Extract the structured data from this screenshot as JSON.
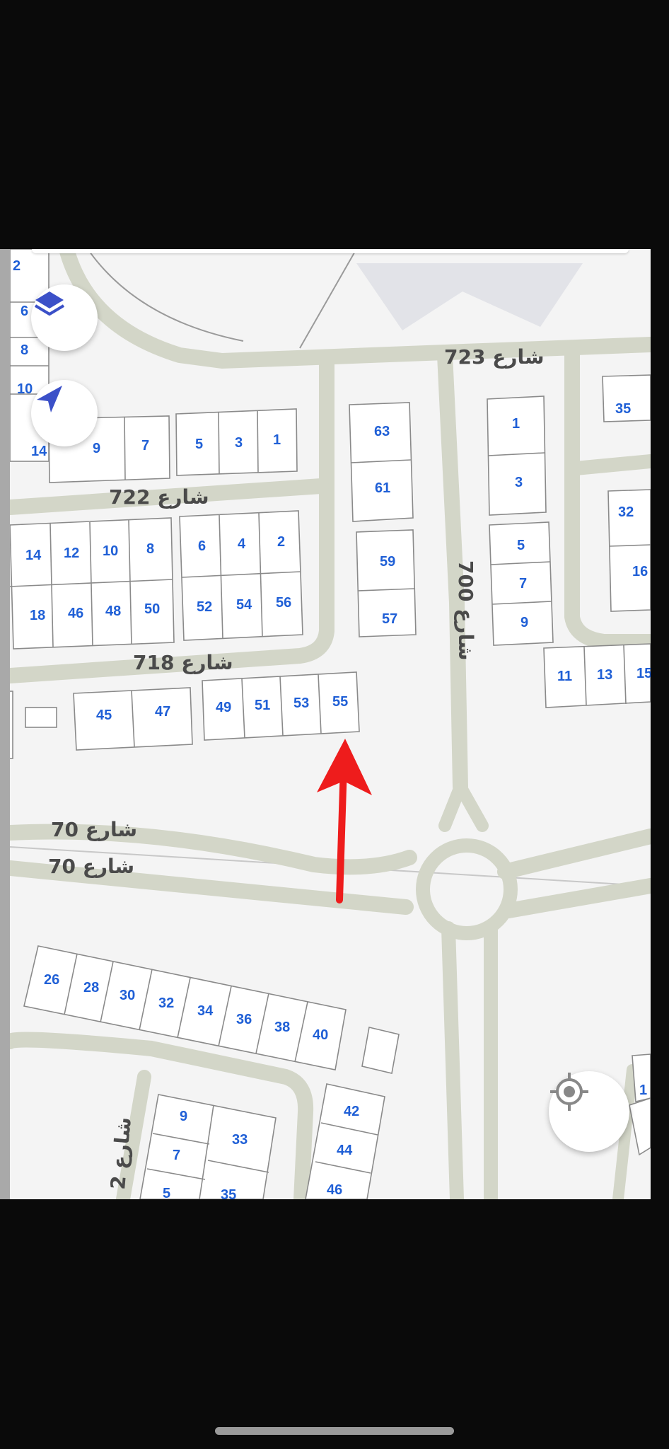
{
  "map": {
    "streets": {
      "s723": "شارع 723",
      "s722": "شارع 722",
      "s718": "شارع 718",
      "s700": "شارع 700",
      "s70a": "شارع 70",
      "s70b": "شارع 70",
      "s2": "شارع 2"
    },
    "plots": {
      "p2": "2",
      "p6": "6",
      "p8": "8",
      "p10a": "10",
      "p14a": "14",
      "p9a": "9",
      "p7a": "7",
      "p5a": "5",
      "p3a": "3",
      "p1a": "1",
      "p63": "63",
      "p61": "61",
      "p59": "59",
      "p57": "57",
      "p1b": "1",
      "p3b": "3",
      "p5b": "5",
      "p7b": "7",
      "p9b": "9",
      "p35a": "35",
      "p32a": "32",
      "p16": "16",
      "p14b": "14",
      "p12": "12",
      "p10b": "10",
      "p8b": "8",
      "p6b": "6",
      "p4": "4",
      "p2b": "2",
      "p18": "18",
      "p46a": "46",
      "p48": "48",
      "p50": "50",
      "p52": "52",
      "p54": "54",
      "p56": "56",
      "p45": "45",
      "p47": "47",
      "p49": "49",
      "p51": "51",
      "p53": "53",
      "p55": "55",
      "p11": "11",
      "p13": "13",
      "p15": "15",
      "p26": "26",
      "p28": "28",
      "p30": "30",
      "p32b": "32",
      "p34": "34",
      "p36": "36",
      "p38": "38",
      "p40": "40",
      "p42": "42",
      "p44": "44",
      "p46b": "46",
      "p9c": "9",
      "p7c": "7",
      "p5c": "5",
      "p33": "33",
      "p35b": "35",
      "p1c": "1"
    }
  },
  "controls": {
    "layers_icon": "layers-icon",
    "navigate_icon": "navigation-arrow-icon",
    "locate_icon": "my-location-icon"
  },
  "annotation": {
    "arrow_color": "#ee1c1c"
  },
  "colors": {
    "road": "#d3d6c8",
    "plot_border": "#8a8a8a",
    "plot_text": "#1f5fd6",
    "background": "#f4f4f4"
  }
}
